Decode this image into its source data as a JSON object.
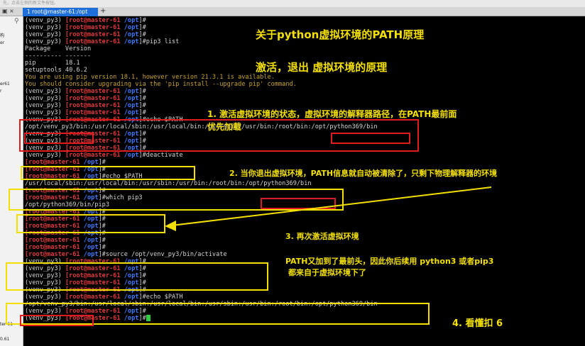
{
  "window": {
    "top_strip_text": "先，点击左侧的新文件按钮。",
    "tab_controls": "▣ ×",
    "active_tab": "1 root@master-61:/opt",
    "new_tab_label": "+"
  },
  "sidebar": {
    "items": [
      "构",
      "er",
      "er61",
      "r",
      "ter 61",
      "0.61"
    ]
  },
  "terminal": {
    "lines": [
      {
        "venv": "(venv_py3) ",
        "user": "[root@master-61 ",
        "path": "/opt",
        "tail": "]#"
      },
      {
        "venv": "(venv_py3) ",
        "user": "[root@master-61 ",
        "path": "/opt",
        "tail": "]#"
      },
      {
        "venv": "(venv_py3) ",
        "user": "[root@master-61 ",
        "path": "/opt",
        "tail": "]#"
      },
      {
        "venv": "(venv_py3) ",
        "user": "[root@master-61 ",
        "path": "/opt",
        "tail": "]#pip3 list"
      },
      {
        "plain": "Package    Version"
      },
      {
        "plain": "---------- -------"
      },
      {
        "plain": "pip        18.1"
      },
      {
        "plain": "setuptools 40.6.2"
      },
      {
        "warn": "You are using pip version 18.1, however version 21.3.1 is available."
      },
      {
        "warn": "You should consider upgrading via the 'pip install --upgrade pip' command."
      },
      {
        "venv": "(venv_py3) ",
        "user": "[root@master-61 ",
        "path": "/opt",
        "tail": "]#"
      },
      {
        "venv": "(venv_py3) ",
        "user": "[root@master-61 ",
        "path": "/opt",
        "tail": "]#"
      },
      {
        "venv": "(venv_py3) ",
        "user": "[root@master-61 ",
        "path": "/opt",
        "tail": "]#"
      },
      {
        "venv": "(venv_py3) ",
        "user": "[root@master-61 ",
        "path": "/opt",
        "tail": "]#"
      },
      {
        "venv": "(venv_py3) ",
        "user": "[root@master-61 ",
        "path": "/opt",
        "tail": "]#echo $PATH"
      },
      {
        "plain": "/opt/venv_py3/bin:/usr/local/sbin:/usr/local/bin:/usr/sbin:/usr/bin:/root/bin:/opt/python369/bin"
      },
      {
        "venv": "(venv_py3) ",
        "user": "[root@master-61 ",
        "path": "/opt",
        "tail": "]#"
      },
      {
        "venv": "(venv_py3) ",
        "user": "[root@master-61 ",
        "path": "/opt",
        "tail": "]#"
      },
      {
        "venv": "(venv_py3) ",
        "user": "[root@master-61 ",
        "path": "/opt",
        "tail": "]#"
      },
      {
        "venv": "(venv_py3) ",
        "user": "[root@master-61 ",
        "path": "/opt",
        "tail": "]#deactivate"
      },
      {
        "user": "[root@master-61 ",
        "path": "/opt",
        "tail": "]#"
      },
      {
        "user": "[root@master-61 ",
        "path": "/opt",
        "tail": "]#"
      },
      {
        "user": "[root@master-61 ",
        "path": "/opt",
        "tail": "]#echo $PATH"
      },
      {
        "plain": "/usr/local/sbin:/usr/local/bin:/usr/sbin:/usr/bin:/root/bin:/opt/python369/bin"
      },
      {
        "user": "[root@master-61 ",
        "path": "/opt",
        "tail": "]#"
      },
      {
        "user": "[root@master-61 ",
        "path": "/opt",
        "tail": "]#which pip3"
      },
      {
        "plain": "/opt/python369/bin/pip3"
      },
      {
        "user": "[root@master-61 ",
        "path": "/opt",
        "tail": "]#"
      },
      {
        "user": "[root@master-61 ",
        "path": "/opt",
        "tail": "]#"
      },
      {
        "user": "[root@master-61 ",
        "path": "/opt",
        "tail": "]#"
      },
      {
        "user": "[root@master-61 ",
        "path": "/opt",
        "tail": "]#"
      },
      {
        "user": "[root@master-61 ",
        "path": "/opt",
        "tail": "]#"
      },
      {
        "user": "[root@master-61 ",
        "path": "/opt",
        "tail": "]#"
      },
      {
        "user": "[root@master-61 ",
        "path": "/opt",
        "tail": "]#source /opt/venv_py3/bin/activate"
      },
      {
        "venv": "(venv_py3) ",
        "user": "[root@master-61 ",
        "path": "/opt",
        "tail": "]#"
      },
      {
        "venv": "(venv_py3) ",
        "user": "[root@master-61 ",
        "path": "/opt",
        "tail": "]#"
      },
      {
        "venv": "(venv_py3) ",
        "user": "[root@master-61 ",
        "path": "/opt",
        "tail": "]#"
      },
      {
        "venv": "(venv_py3) ",
        "user": "[root@master-61 ",
        "path": "/opt",
        "tail": "]#"
      },
      {
        "venv": "(venv_py3) ",
        "user": "[root@master-61 ",
        "path": "/opt",
        "tail": "]#"
      },
      {
        "venv": "(venv_py3) ",
        "user": "[root@master-61 ",
        "path": "/opt",
        "tail": "]#echo $PATH"
      },
      {
        "plain": "/opt/venv_py3/bin:/usr/local/sbin:/usr/local/bin:/usr/sbin:/usr/bin:/root/bin:/opt/python369/bin"
      },
      {
        "venv": "(venv_py3) ",
        "user": "[root@master-61 ",
        "path": "/opt",
        "tail": "]#"
      },
      {
        "venv": "(venv_py3) ",
        "user": "[root@master-61 ",
        "path": "/opt",
        "tail": "]#",
        "cursor": true
      }
    ]
  },
  "annotations": {
    "title": "关于python虚拟环境的PATH原理",
    "subtitle": "激活，退出 虚拟环境的原理",
    "note1_line1": "1. 激活虚拟环境的状态，虚拟环境的解释器路径，在PATH最前面",
    "note1_line2": "优先加载",
    "note2": "2. 当你退出虚拟环境，PATH信息就自动被清除了，只剩下物理解释器的环境",
    "note3": "3. 再次激活虚拟环境",
    "note3_detail1": "PATH又加到了最前头，因此你后续用 python3 或者pip3",
    "note3_detail2": "都来自于虚拟环境下了",
    "note4": "4. 看懂扣 6"
  },
  "colors": {
    "background": "#000000",
    "prompt_user": "#e03a3a",
    "prompt_path": "#3a7bff",
    "warning": "#c9a227",
    "annotation": "#f4e000",
    "highlight_box": "#e01b1b"
  }
}
